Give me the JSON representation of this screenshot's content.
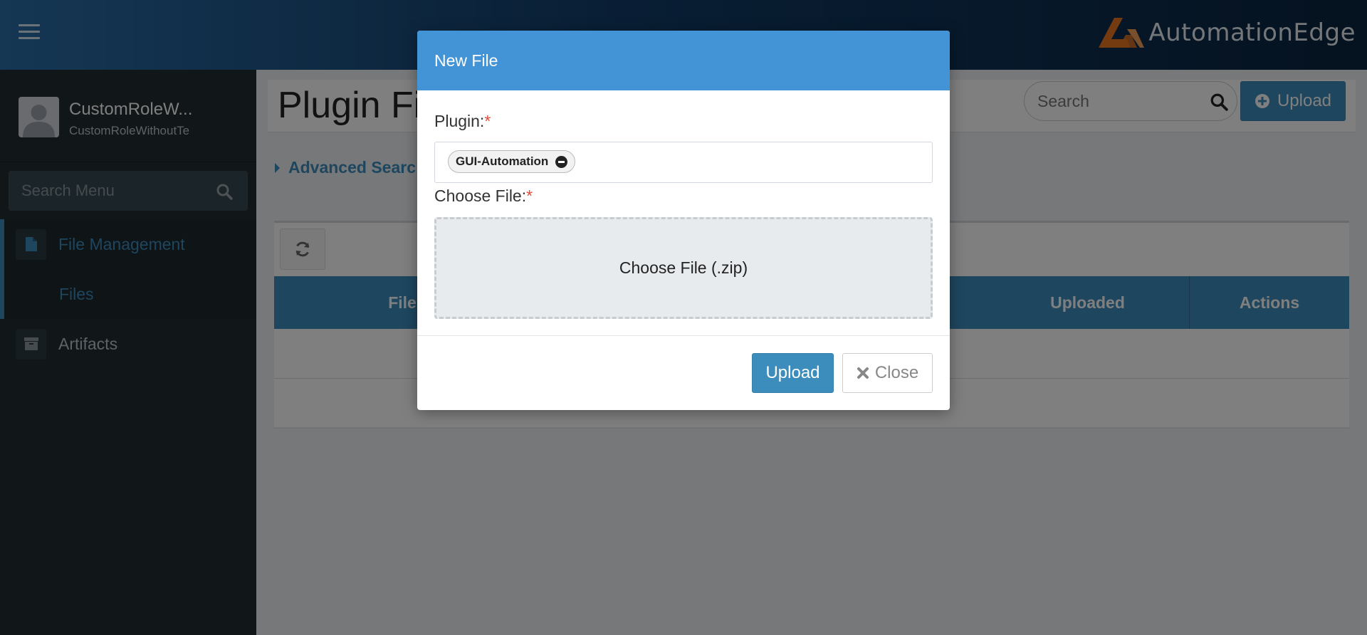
{
  "header": {
    "menu_icon": "hamburger-icon",
    "logo_text": "AutomationEdge",
    "logo_mark_color": "#e87722"
  },
  "sidebar": {
    "user": {
      "name": "CustomRoleW...",
      "subtitle": "CustomRoleWithoutTe"
    },
    "search": {
      "placeholder": "Search Menu",
      "icon": "search-icon"
    },
    "items": [
      {
        "label": "File Management",
        "icon": "file-icon",
        "active": true
      },
      {
        "label": "Files",
        "active": true
      },
      {
        "label": "Artifacts",
        "icon": "archive-icon"
      }
    ]
  },
  "content": {
    "title": "Plugin Fil",
    "search": {
      "placeholder": "Search",
      "icon": "search-icon"
    },
    "upload_button": "Upload",
    "advanced_search": "Advanced Searc",
    "table": {
      "refresh_icon": "refresh-icon",
      "columns": [
        "File",
        "Uploaded",
        "Actions"
      ]
    }
  },
  "modal": {
    "title": "New File",
    "plugin_label": "Plugin:",
    "file_label": "Choose File:",
    "required_mark": "*",
    "selected_plugin": "GUI-Automation",
    "dropzone_text": "Choose File (.zip)",
    "upload_button": "Upload",
    "close_button": "Close"
  },
  "colors": {
    "accent": "#3c8dbc",
    "modal_header": "#4294d6",
    "sidebar_bg": "#222d32",
    "required": "#dd4b39"
  }
}
